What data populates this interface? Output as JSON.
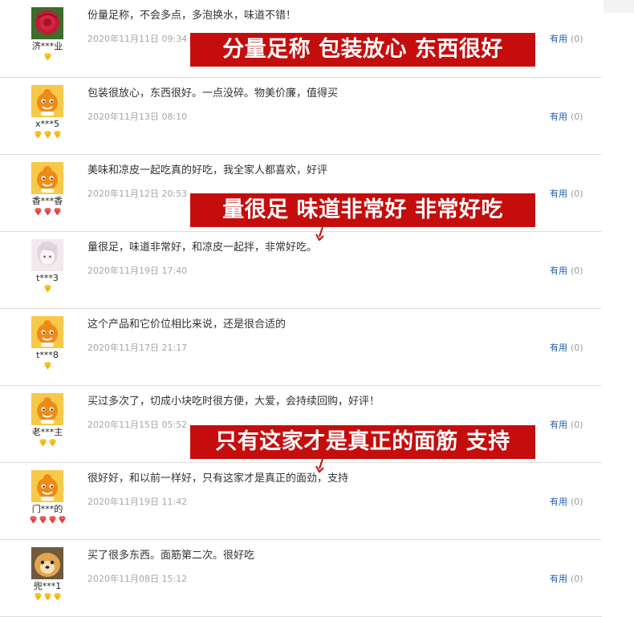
{
  "useful_label": "有用",
  "reviews": [
    {
      "user": "济***业",
      "text": "份量足称，不会多点，多泡换水，味道不错！",
      "date": "2020年11月11日 09:34",
      "useful_count": "(0)",
      "avatar": "flower",
      "level": "gold",
      "level_count": 1
    },
    {
      "user": "x***5",
      "text": "包装很放心，东西很好。一点没碎。物美价廉，值得买",
      "date": "2020年11月13日 08:10",
      "useful_count": "(0)",
      "avatar": "mascot",
      "level": "gold",
      "level_count": 3
    },
    {
      "user": "香***香",
      "text": "美味和凉皮一起吃真的好吃，我全家人都喜欢，好评",
      "date": "2020年11月12日 20:53",
      "useful_count": "(0)",
      "avatar": "mascot",
      "level": "red",
      "level_count": 3
    },
    {
      "user": "t***3",
      "text": "量很足，味道非常好，和凉皮一起拌，非常好吃。",
      "date": "2020年11月19日 17:40",
      "useful_count": "(0)",
      "avatar": "anime",
      "level": "gold",
      "level_count": 1
    },
    {
      "user": "t***8",
      "text": "这个产品和它价位相比来说，还是很合适的",
      "date": "2020年11月17日 21:17",
      "useful_count": "(0)",
      "avatar": "mascot",
      "level": "gold",
      "level_count": 1
    },
    {
      "user": "老***主",
      "text": "买过多次了，切成小块吃时很方便，大爱，会持续回购，好评！",
      "date": "2020年11月15日 05:52",
      "useful_count": "(0)",
      "avatar": "mascot",
      "level": "gold",
      "level_count": 2
    },
    {
      "user": "门***的",
      "text": "很好好，和以前一样好，只有这家才是真正的面劲，支持",
      "date": "2020年11月19日 11:42",
      "useful_count": "(0)",
      "avatar": "mascot",
      "level": "red",
      "level_count": 4
    },
    {
      "user": "兜***1",
      "text": "买了很多东西。面筋第二次。很好吃",
      "date": "2020年11月08日 15:12",
      "useful_count": "(0)",
      "avatar": "dog",
      "level": "gold",
      "level_count": 3
    }
  ],
  "banners": [
    {
      "text": "分量足称  包装放心 东西很好"
    },
    {
      "text": "量很足 味道非常好 非常好吃"
    },
    {
      "text": "只有这家才是真正的面筋 支持"
    }
  ],
  "colors": {
    "banner_bg": "#c50d0d",
    "link": "#1f5ea8",
    "date": "#a6a6a6",
    "mascot": "#f39a1e",
    "gold_level": "#f4b400",
    "red_level": "#e23c3c"
  }
}
